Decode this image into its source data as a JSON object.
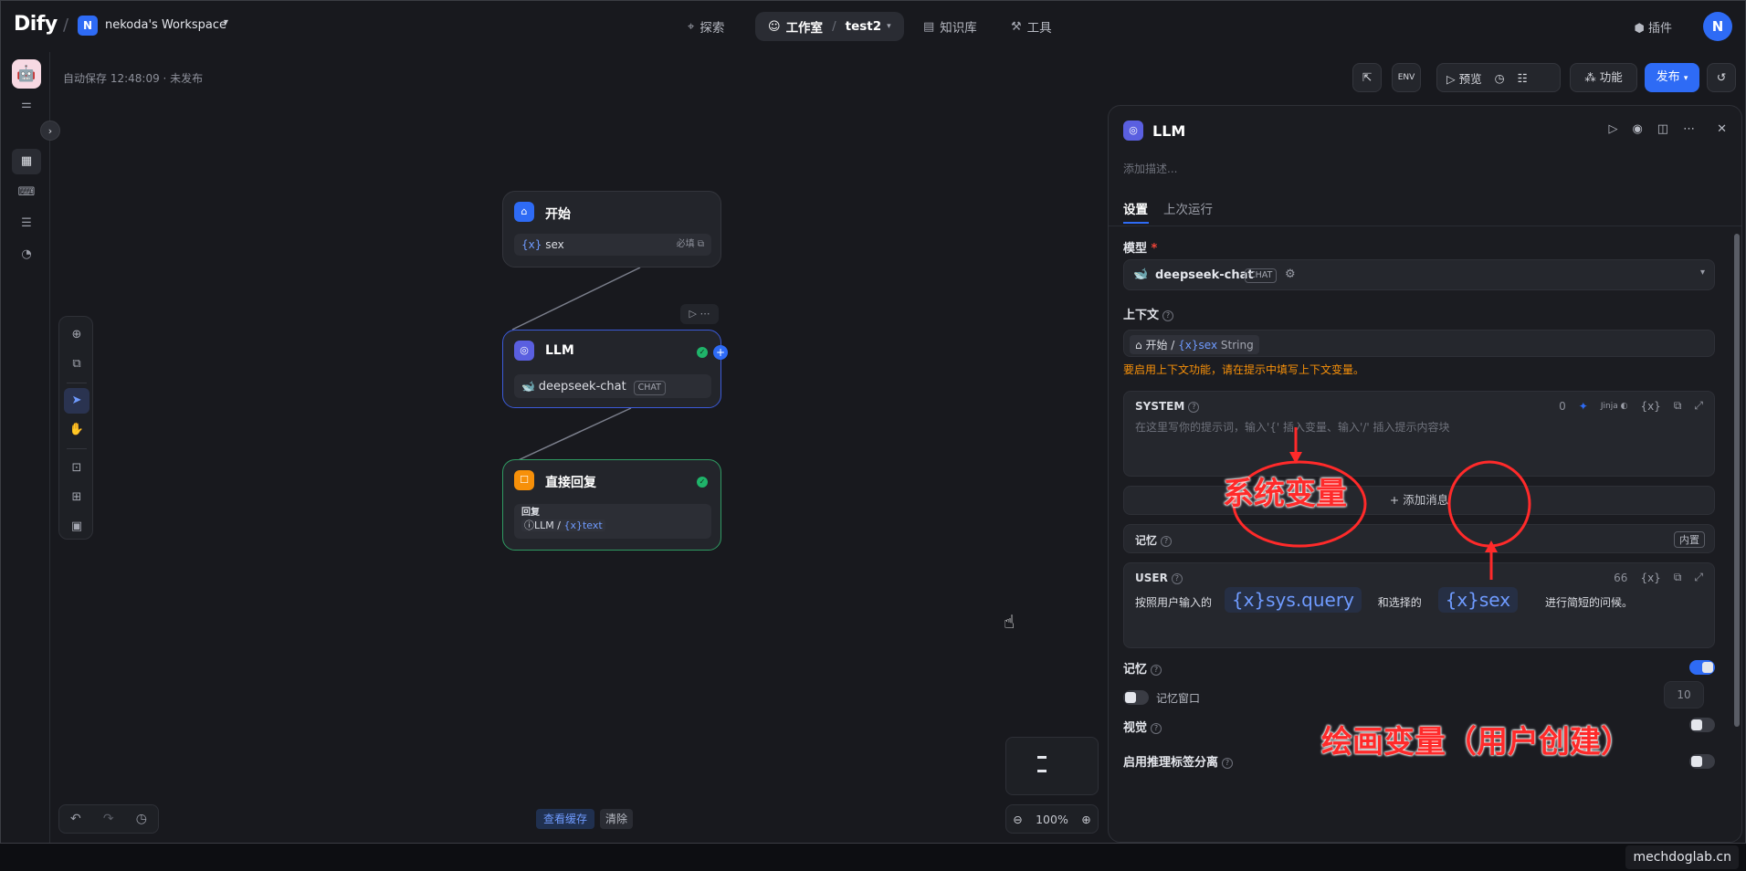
{
  "topbar": {
    "logo": "Dify",
    "workspace_initial": "N",
    "workspace_name": "nekoda's Workspace",
    "nav_explore": "探索",
    "nav_studio": "工作室",
    "nav_app": "test2",
    "nav_knowledge": "知识库",
    "nav_tools": "工具",
    "plugins": "插件",
    "avatar_initial": "N"
  },
  "canvas": {
    "autosave": "自动保存 12:48:09 · 未发布",
    "preview": "预览",
    "features": "功能",
    "publish": "发布",
    "view_cache": "查看缓存",
    "clear": "清除",
    "zoom": "100%"
  },
  "nodes": {
    "start": {
      "title": "开始",
      "var": "sex",
      "required": "必填"
    },
    "llm": {
      "title": "LLM",
      "model": "deepseek-chat",
      "tag": "CHAT"
    },
    "reply": {
      "title": "直接回复",
      "label": "回复",
      "src": "LLM",
      "var": "text"
    }
  },
  "panel": {
    "title": "LLM",
    "desc_placeholder": "添加描述...",
    "tab_settings": "设置",
    "tab_last_run": "上次运行",
    "model_label": "模型",
    "model_name": "deepseek-chat",
    "model_tag": "CHAT",
    "context_label": "上下文",
    "context_src": "开始",
    "context_var": "sex",
    "context_type": "String",
    "context_warning": "要启用上下文功能，请在提示中填写上下文变量。",
    "system_label": "SYSTEM",
    "system_count": "0",
    "jinja": "Jinja",
    "system_placeholder": "在这里写你的提示词，输入'{' 插入变量、输入'/' 插入提示内容块",
    "add_message": "+ 添加消息",
    "memory_card_label": "记忆",
    "memory_builtin": "内置",
    "user_label": "USER",
    "user_count": "66",
    "user_text_1": "按照用户输入的",
    "user_var_1": "sys.query",
    "user_text_2": "和选择的",
    "user_var_2": "sex",
    "user_text_3": "进行简短的问候。",
    "memory_label": "记忆",
    "memory_window_label": "记忆窗口",
    "memory_window_value": "10",
    "vision_label": "视觉",
    "reasoning_label": "启用推理标签分离"
  },
  "annotations": {
    "system_var": "系统变量",
    "user_var": "绘画变量（用户创建）"
  },
  "watermark": "mechdoglab.cn",
  "colors": {
    "accent": "#2e6bf5",
    "success": "#1fb46a",
    "warning": "#f79009",
    "annotation": "#ff2a2a"
  }
}
